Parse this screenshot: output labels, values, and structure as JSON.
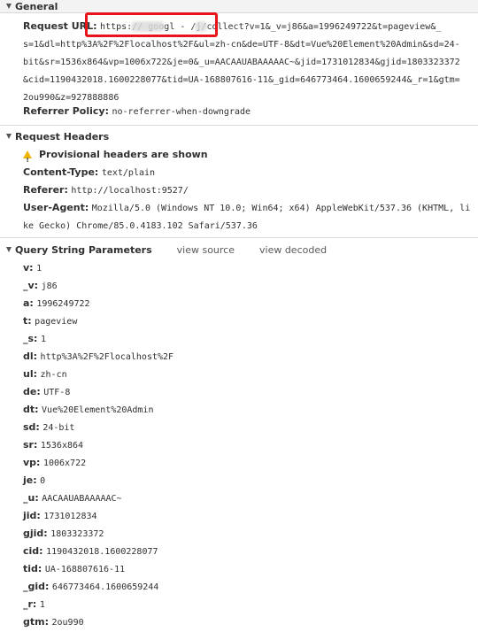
{
  "general": {
    "title": "General",
    "request_url_label": "Request URL:",
    "request_url_lines": [
      "https://         googl   -   /j/collect?v=1&_v=j86&a=1996249722&t=pageview&_",
      "s=1&dl=http%3A%2F%2Flocalhost%2F&ul=zh-cn&de=UTF-8&dt=Vue%20Element%20Admin&sd=24-",
      "bit&sr=1536x864&vp=1006x722&je=0&_u=AACAAUABAAAAAC~&jid=1731012834&gjid=1803323372",
      "&cid=1190432018.1600228077&tid=UA-168807616-11&_gid=646773464.1600659244&_r=1&gtm=",
      "2ou990&z=927888886"
    ],
    "referrer_policy_label": "Referrer Policy:",
    "referrer_policy_value": "no-referrer-when-downgrade"
  },
  "request_headers": {
    "title": "Request Headers",
    "warning": "Provisional headers are shown",
    "content_type_label": "Content-Type:",
    "content_type_value": "text/plain",
    "referer_label": "Referer:",
    "referer_value": "http://localhost:9527/",
    "user_agent_label": "User-Agent:",
    "user_agent_line1": "Mozilla/5.0 (Windows NT 10.0; Win64; x64) AppleWebKit/537.36 (KHTML, li",
    "user_agent_line2": "ke Gecko) Chrome/85.0.4183.102 Safari/537.36"
  },
  "query_params": {
    "title": "Query String Parameters",
    "view_source": "view source",
    "view_decoded": "view decoded",
    "params": [
      {
        "k": "v:",
        "v": "1"
      },
      {
        "k": "_v:",
        "v": "j86"
      },
      {
        "k": "a:",
        "v": "1996249722"
      },
      {
        "k": "t:",
        "v": "pageview"
      },
      {
        "k": "_s:",
        "v": "1"
      },
      {
        "k": "dl:",
        "v": "http%3A%2F%2Flocalhost%2F"
      },
      {
        "k": "ul:",
        "v": "zh-cn"
      },
      {
        "k": "de:",
        "v": "UTF-8"
      },
      {
        "k": "dt:",
        "v": "Vue%20Element%20Admin"
      },
      {
        "k": "sd:",
        "v": "24-bit"
      },
      {
        "k": "sr:",
        "v": "1536x864"
      },
      {
        "k": "vp:",
        "v": "1006x722"
      },
      {
        "k": "je:",
        "v": "0"
      },
      {
        "k": "_u:",
        "v": "AACAAUABAAAAAC~"
      },
      {
        "k": "jid:",
        "v": "1731012834"
      },
      {
        "k": "gjid:",
        "v": "1803323372"
      },
      {
        "k": "cid:",
        "v": "1190432018.1600228077"
      },
      {
        "k": "tid:",
        "v": "UA-168807616-11"
      },
      {
        "k": "_gid:",
        "v": "646773464.1600659244"
      },
      {
        "k": "_r:",
        "v": "1"
      },
      {
        "k": "gtm:",
        "v": "2ou990"
      }
    ]
  },
  "colors": {
    "highlight_box": "#e8141c",
    "warning_icon": "#f0b400"
  }
}
